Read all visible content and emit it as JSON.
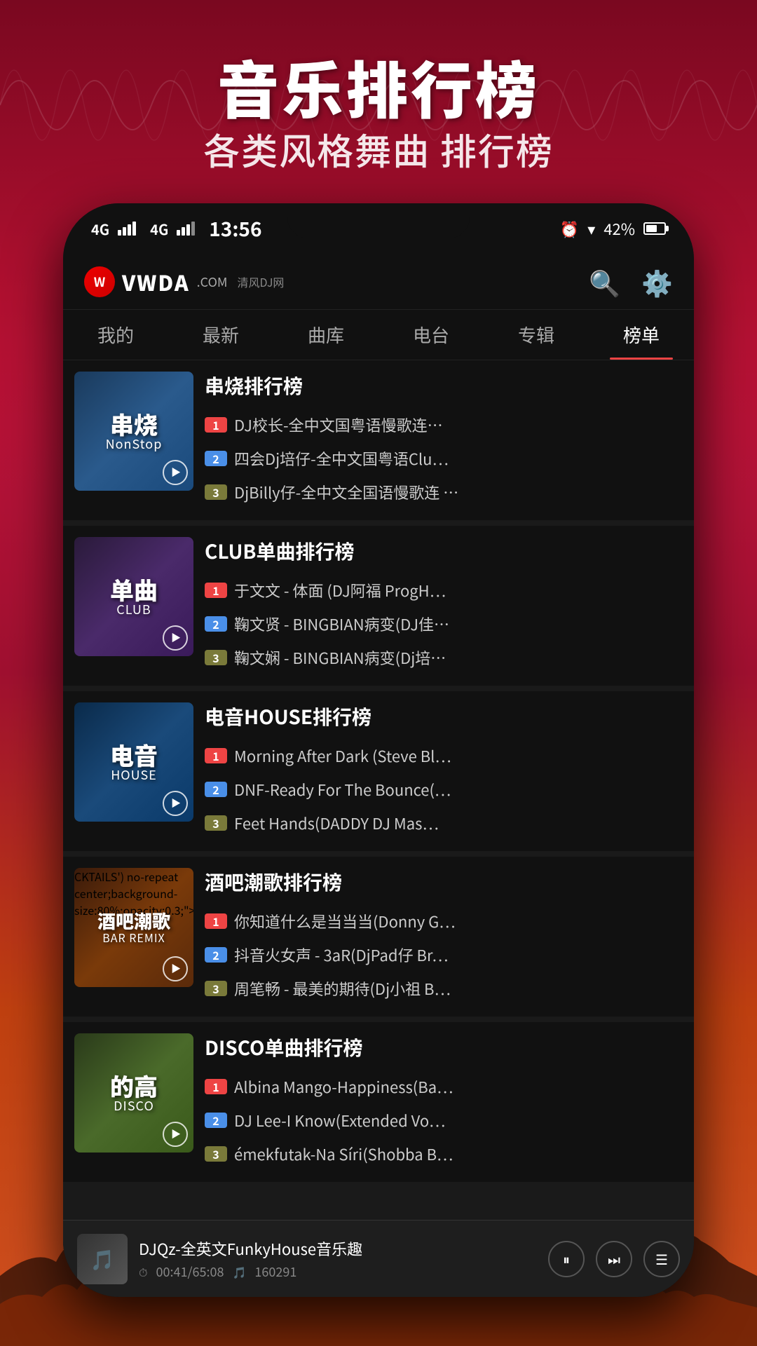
{
  "page": {
    "title": "音乐排行榜",
    "subtitle": "各类风格舞曲 排行榜",
    "bg_color": "#8B0A2A"
  },
  "status_bar": {
    "signal1": "4G",
    "signal2": "4G",
    "time": "13:56",
    "alarm": "⏰",
    "wifi": "WiFi",
    "battery": "42%"
  },
  "header": {
    "logo_text": "VWDA",
    "logo_com": ".COM",
    "logo_sub": "清风DJ网",
    "search_icon": "search",
    "settings_icon": "settings"
  },
  "nav": {
    "tabs": [
      {
        "label": "我的",
        "active": false
      },
      {
        "label": "最新",
        "active": false
      },
      {
        "label": "曲库",
        "active": false
      },
      {
        "label": "电台",
        "active": false
      },
      {
        "label": "专辑",
        "active": false
      },
      {
        "label": "榜单",
        "active": true
      }
    ]
  },
  "charts": [
    {
      "id": "chuanshao",
      "thumb_label": "串烧",
      "thumb_sub": "NonStop",
      "title": "串烧排行榜",
      "tracks": [
        {
          "rank": 1,
          "name": "DJ校长-全中文国粤语慢歌连…"
        },
        {
          "rank": 2,
          "name": "四会Dj培仔-全中文国粤语Clu…"
        },
        {
          "rank": 3,
          "name": "DjBilly仔-全中文全国语慢歌连 …"
        }
      ]
    },
    {
      "id": "club",
      "thumb_label": "单曲",
      "thumb_sub": "CLUB",
      "title": "CLUB单曲排行榜",
      "tracks": [
        {
          "rank": 1,
          "name": "于文文 - 体面 (DJ阿福 ProgH…"
        },
        {
          "rank": 2,
          "name": "鞠文贤 - BINGBIAN病变(DJ佳…"
        },
        {
          "rank": 3,
          "name": "鞠文娴 - BINGBIAN病变(Dj培…"
        }
      ]
    },
    {
      "id": "house",
      "thumb_label": "电音",
      "thumb_sub": "HOUSE",
      "title": "电音HOUSE排行榜",
      "tracks": [
        {
          "rank": 1,
          "name": "Morning After Dark (Steve Bl…"
        },
        {
          "rank": 2,
          "name": "DNF-Ready For The Bounce(…"
        },
        {
          "rank": 3,
          "name": "Feet Hands(DADDY DJ Mas…"
        }
      ]
    },
    {
      "id": "bar",
      "thumb_label": "酒吧潮歌",
      "thumb_sub": "BAR REMIX",
      "title": "酒吧潮歌排行榜",
      "tracks": [
        {
          "rank": 1,
          "name": "你知道什么是当当当(Donny G…"
        },
        {
          "rank": 2,
          "name": "抖音火女声 - 3aR(DjPad仔 Br…"
        },
        {
          "rank": 3,
          "name": "周笔畅 - 最美的期待(Dj小祖 B…"
        }
      ]
    },
    {
      "id": "disco",
      "thumb_label": "的高",
      "thumb_sub": "DISCO",
      "title": "DISCO单曲排行榜",
      "tracks": [
        {
          "rank": 1,
          "name": "Albina Mango-Happiness(Ba…"
        },
        {
          "rank": 2,
          "name": "DJ Lee-I Know(Extended Vo…"
        },
        {
          "rank": 3,
          "name": "émekfutak-Na Síri(Shobba B…"
        }
      ]
    }
  ],
  "mini_player": {
    "title": "DJQz-全英文FunkyHouse音乐趣",
    "time": "00:41/65:08",
    "count_icon": "🎵",
    "count": "160291",
    "play_icon": "⏸",
    "next_icon": "⏭",
    "menu_icon": "☰"
  }
}
